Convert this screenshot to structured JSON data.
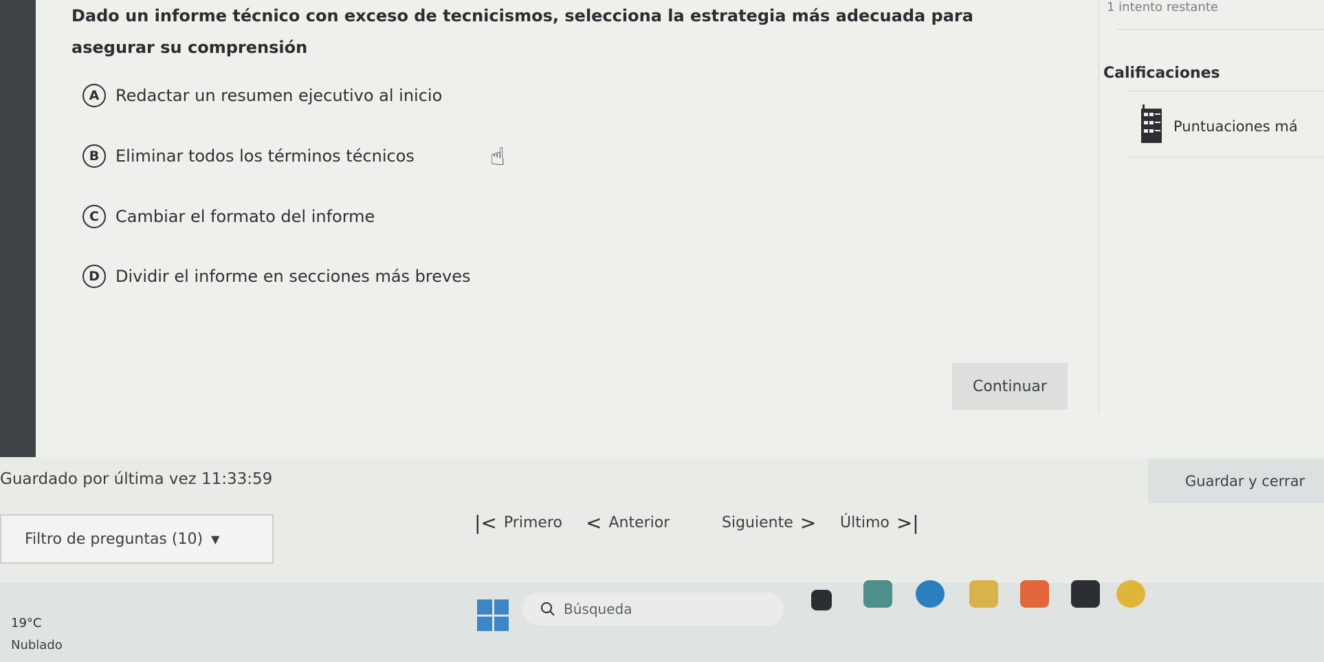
{
  "question": {
    "text": "Dado un informe técnico con exceso de tecnicismos, selecciona la estrategia más adecuada para asegurar su comprensión"
  },
  "options": [
    {
      "letter": "A",
      "text": "Redactar un resumen ejecutivo al inicio"
    },
    {
      "letter": "B",
      "text": "Eliminar todos los términos técnicos"
    },
    {
      "letter": "C",
      "text": "Cambiar el formato del informe"
    },
    {
      "letter": "D",
      "text": "Dividir el informe en secciones más breves"
    }
  ],
  "continue_label": "Continuar",
  "side": {
    "intentos": "1 intento restante",
    "calificaciones_title": "Calificaciones",
    "puntuaciones": "Puntuaciones má"
  },
  "footer": {
    "saved_text": "Guardado por última vez 11:33:59",
    "save_close_label": "Guardar y cerrar",
    "filter_label": "Filtro de preguntas (10)",
    "first_label": "Primero",
    "prev_label": "Anterior",
    "next_label": "Siguiente",
    "last_label": "Último"
  },
  "taskbar": {
    "temp": "19°C",
    "weather": "Nublado",
    "search_placeholder": "Búsqueda"
  },
  "icons": {
    "hand": "hand-pointer-icon",
    "grade": "gradebook-icon",
    "windows": "windows-start-icon",
    "search": "search-icon"
  },
  "colors": {
    "panel_bg": "#eef0ec",
    "dark_strip": "#3f4448",
    "taskbar_bg": "#dfe3e2",
    "windows_blue": "#3d86c6"
  }
}
